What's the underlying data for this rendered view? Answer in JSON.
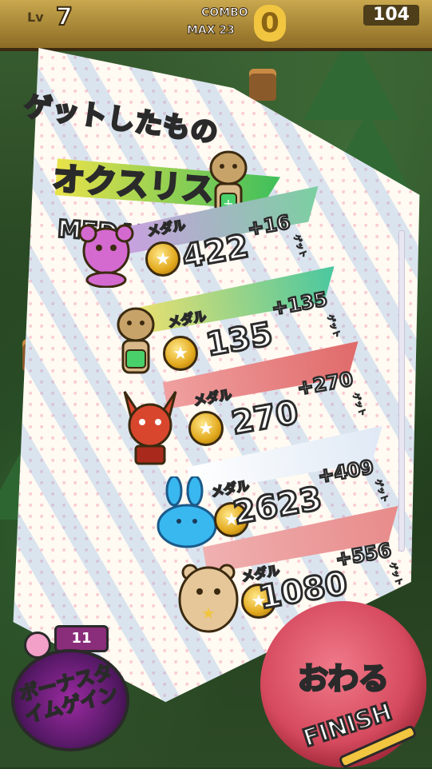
{
  "hud": {
    "level_label": "Lv",
    "level": "7",
    "combo_label": "COMBO",
    "max_label": "MAX 23",
    "combo_value": "0",
    "right_value": "104"
  },
  "card": {
    "title_jp": "ゲットしたもの",
    "subtitle": "オクスリス",
    "medals_header": "MEDALS",
    "rows": [
      {
        "label": "メダル",
        "value": "422",
        "gain": "+16",
        "get": "ゲット",
        "bar_color": "#c9a0e0",
        "char": "pink-bear"
      },
      {
        "label": "メダル",
        "value": "135",
        "gain": "+135",
        "get": "ゲット",
        "bar_color": "#9ad6a0",
        "char": "squirrel"
      },
      {
        "label": "メダル",
        "value": "270",
        "gain": "+270",
        "get": "ゲット",
        "bar_color": "#e06a6a",
        "char": "red-fox"
      },
      {
        "label": "メダル",
        "value": "2623",
        "gain": "+409",
        "get": "ゲット",
        "bar_color": "#8ad0e8",
        "char": "blue-slime"
      },
      {
        "label": "メダル",
        "value": "1080",
        "gain": "+556",
        "get": "ゲット",
        "bar_color": "#f0a0a0",
        "char": "hamster"
      }
    ]
  },
  "bonus": {
    "count": "11",
    "text": "ボーナスタイムゲイン"
  },
  "finish": {
    "jp": "おわる",
    "en": "FINISH"
  }
}
